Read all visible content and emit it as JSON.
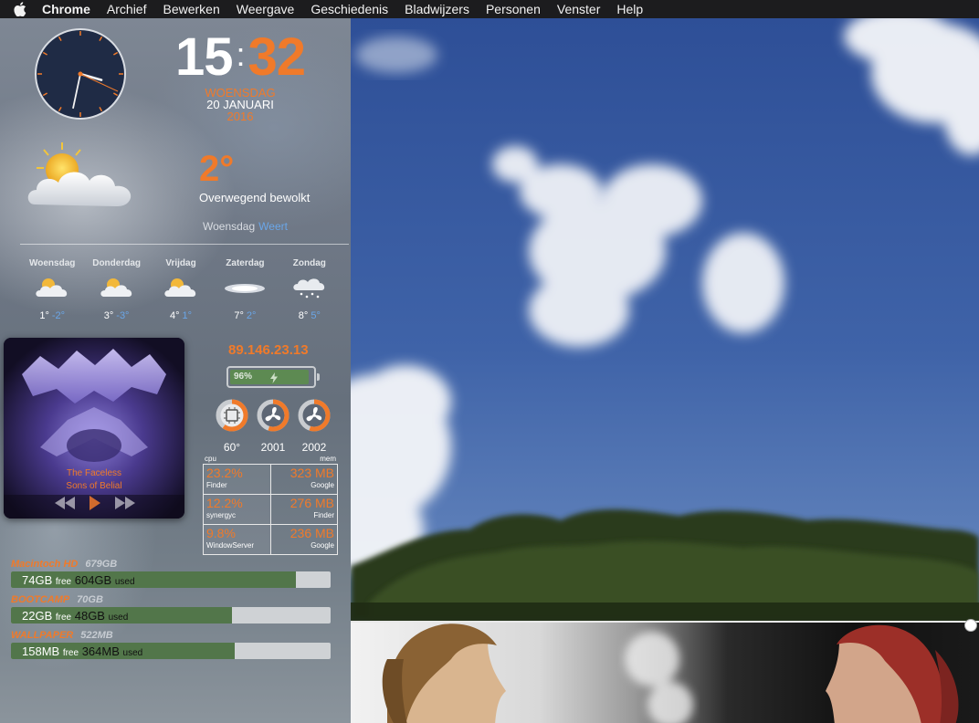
{
  "menubar": {
    "app": "Chrome",
    "items": [
      "Archief",
      "Bewerken",
      "Weergave",
      "Geschiedenis",
      "Bladwijzers",
      "Personen",
      "Venster",
      "Help"
    ]
  },
  "clock": {
    "hours": "15",
    "minutes": "32",
    "day": "WOENSDAG",
    "date": "20 JANUARI",
    "year": "2016",
    "analog_hour": 15,
    "analog_minute": 32
  },
  "weather": {
    "temperature": "2°",
    "condition": "Overwegend bewolkt",
    "day": "Woensdag",
    "city": "Weert",
    "icon": "partly-cloudy-icon",
    "forecast": [
      {
        "day": "Woensdag",
        "high": "1°",
        "low": "-2°",
        "icon": "partly-cloudy-icon"
      },
      {
        "day": "Donderdag",
        "high": "3°",
        "low": "-3°",
        "icon": "partly-cloudy-icon"
      },
      {
        "day": "Vrijdag",
        "high": "4°",
        "low": "1°",
        "icon": "partly-cloudy-icon"
      },
      {
        "day": "Zaterdag",
        "high": "7°",
        "low": "2°",
        "icon": "fog-icon"
      },
      {
        "day": "Zondag",
        "high": "8°",
        "low": "5°",
        "icon": "snow-cloud-icon"
      }
    ]
  },
  "music": {
    "track": "The Faceless",
    "album": "Sons of Belial"
  },
  "system": {
    "ip": "89.146.23.13",
    "battery_percent": "96%",
    "battery_level": 0.96,
    "gauges": [
      {
        "label": "60°",
        "icon": "cpu-chip-icon",
        "level": 0.6
      },
      {
        "label": "2001",
        "icon": "fan-icon",
        "level": 0.55
      },
      {
        "label": "2002",
        "icon": "fan-icon",
        "level": 0.55
      }
    ],
    "processes_header": {
      "cpu": "cpu",
      "mem": "mem"
    },
    "processes": [
      {
        "cpu_value": "23.2%",
        "cpu_name": "Finder",
        "mem_value": "323 MB",
        "mem_name": "Google"
      },
      {
        "cpu_value": "12.2%",
        "cpu_name": "synergyc",
        "mem_value": "276 MB",
        "mem_name": "Finder"
      },
      {
        "cpu_value": "9.8%",
        "cpu_name": "WindowServer",
        "mem_value": "236 MB",
        "mem_name": "Google"
      }
    ]
  },
  "disks": [
    {
      "name": "Macintoch HD",
      "size": "679GB",
      "free": "74GB",
      "free_label": "free",
      "used": "604GB",
      "used_label": "used",
      "used_fraction": 0.89
    },
    {
      "name": "BOOTCAMP",
      "size": "70GB",
      "free": "22GB",
      "free_label": "free",
      "used": "48GB",
      "used_label": "used",
      "used_fraction": 0.69
    },
    {
      "name": "WALLPAPER",
      "size": "522MB",
      "free": "158MB",
      "free_label": "free",
      "used": "364MB",
      "used_label": "used",
      "used_fraction": 0.7
    }
  ],
  "colors": {
    "accent_orange": "#f07a2a",
    "accent_blue": "#6aa6e8",
    "disk_used": "#52764a"
  }
}
